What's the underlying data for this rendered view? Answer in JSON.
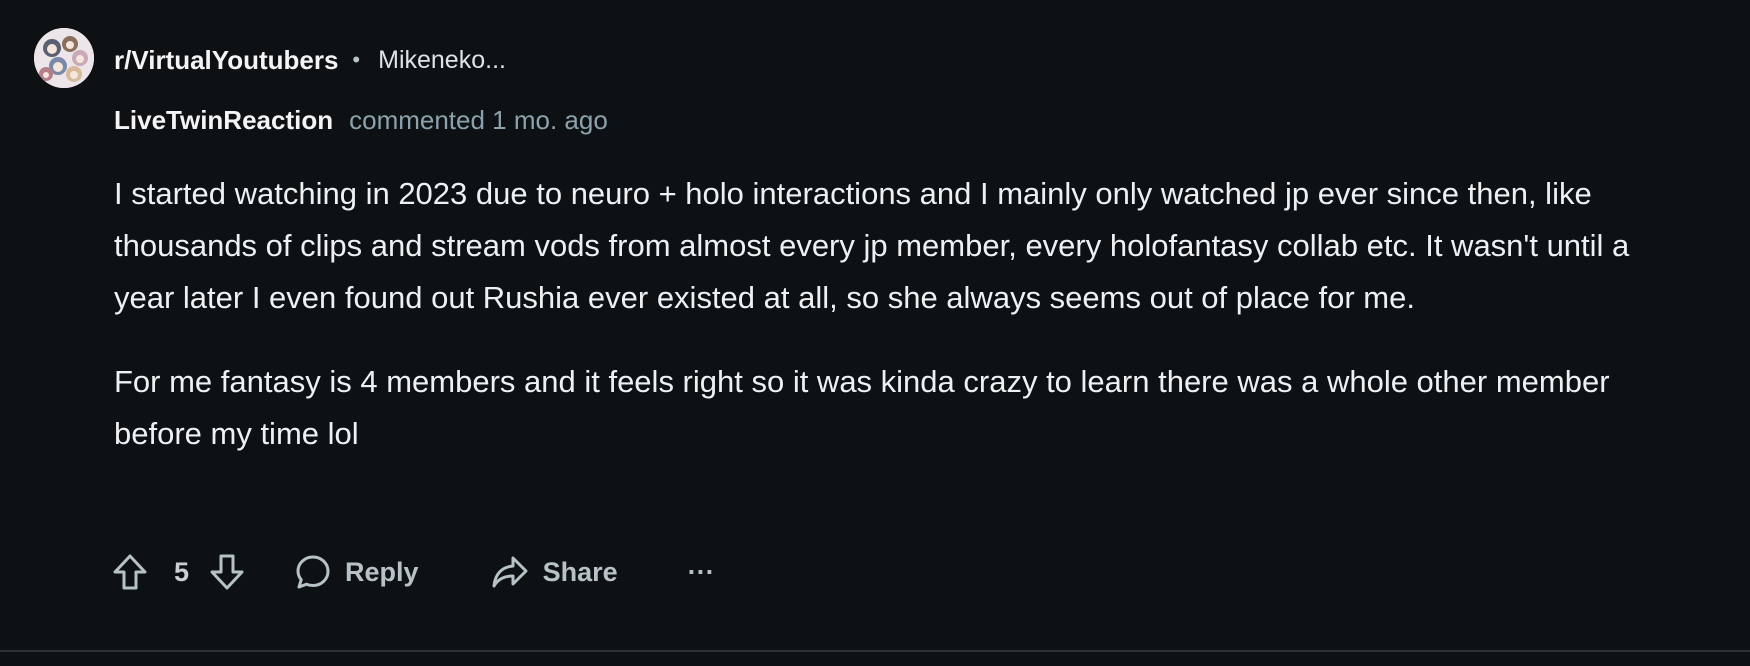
{
  "header": {
    "subreddit": "r/VirtualYoutubers",
    "separator": "•",
    "post_title": "Mikeneko..."
  },
  "comment": {
    "author": "LiveTwinReaction",
    "meta": "commented 1 mo. ago",
    "paragraphs": [
      "I started watching in 2023 due to neuro + holo interactions and I mainly only watched jp ever since then, like thousands of clips and stream vods from almost every jp member, every holofantasy collab etc. It wasn't until a year later I even found out Rushia ever existed at all, so she always seems out of place for me.",
      "For me fantasy is 4 members and it feels right so it was kinda crazy to learn there was a whole other member before my time lol"
    ]
  },
  "actions": {
    "upvote_icon": "arrow-up-icon",
    "vote_count": "5",
    "downvote_icon": "arrow-down-icon",
    "reply_label": "Reply",
    "reply_icon": "speech-bubble-icon",
    "share_label": "Share",
    "share_icon": "share-arrow-icon",
    "more_label": "···"
  },
  "colors": {
    "background": "#0e1113",
    "text": "#f2f4f5",
    "muted": "#8ba2ad",
    "action": "#b7c2c7"
  }
}
